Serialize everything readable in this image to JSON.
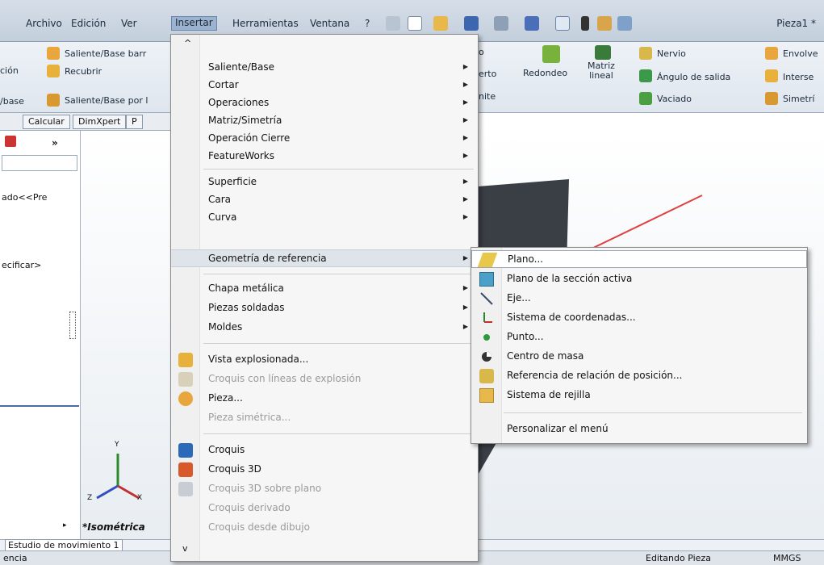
{
  "menubar": {
    "items": [
      "Archivo",
      "Edición",
      "Ver",
      "Insertar",
      "Herramientas",
      "Ventana",
      "?"
    ],
    "active": "Insertar",
    "document_title": "Pieza1 *"
  },
  "ribbon": {
    "left_labels": [
      "Saliente/Base barr",
      "Recubrir",
      "Saliente/Base por l"
    ],
    "left_cut": [
      "ción",
      "/base"
    ],
    "mid_cut": [
      "o",
      "erto",
      "nite"
    ],
    "redondeo": "Redondeo",
    "matriz": "Matriz\nlineal",
    "right_labels": [
      "Nervio",
      "Ángulo de salida",
      "Vaciado"
    ],
    "far_labels": [
      "Envolve",
      "Interse",
      "Simetrí"
    ]
  },
  "command_tabs": [
    "Calcular",
    "DimXpert",
    "P"
  ],
  "left_panel": {
    "tree_text_1": "ado<<Pre",
    "tree_text_2": "ecificar>"
  },
  "viewport": {
    "view_label": "*Isométrica",
    "axis_y": "Y",
    "axis_x": "X",
    "axis_z": "Z"
  },
  "bottom": {
    "tab_label": "Estudio de movimiento 1",
    "status_left": "encia",
    "status_mid": "Editando Pieza",
    "status_right": "MMGS"
  },
  "insert_menu": {
    "top_arrow": "^",
    "bottom_arrow": "v",
    "items": [
      {
        "label": "Saliente/Base",
        "sub": true
      },
      {
        "label": "Cortar",
        "sub": true
      },
      {
        "label": "Operaciones",
        "sub": true
      },
      {
        "label": "Matriz/Simetría",
        "sub": true
      },
      {
        "label": "Operación Cierre",
        "sub": true
      },
      {
        "label": "FeatureWorks",
        "sub": true
      },
      {
        "label": "Superficie",
        "sub": true
      },
      {
        "label": "Cara",
        "sub": true
      },
      {
        "label": "Curva",
        "sub": true
      },
      {
        "label": "Geometría de referencia",
        "sub": true
      },
      {
        "label": "Chapa metálica",
        "sub": true
      },
      {
        "label": "Piezas soldadas",
        "sub": true
      },
      {
        "label": "Moldes",
        "sub": true
      },
      {
        "label": "Vista explosionada...",
        "sub": false
      },
      {
        "label": "Croquis con líneas de explosión",
        "sub": false
      },
      {
        "label": "Pieza...",
        "sub": false
      },
      {
        "label": "Pieza simétrica...",
        "sub": false
      },
      {
        "label": "Croquis",
        "sub": false
      },
      {
        "label": "Croquis 3D",
        "sub": false
      },
      {
        "label": "Croquis 3D sobre plano",
        "sub": false
      },
      {
        "label": "Croquis derivado",
        "sub": false
      },
      {
        "label": "Croquis desde dibujo",
        "sub": false
      }
    ]
  },
  "ref_geometry_submenu": {
    "items": [
      "Plano...",
      "Plano de la sección activa",
      "Eje...",
      "Sistema de coordenadas...",
      "Punto...",
      "Centro de masa",
      "Referencia de relación de posición...",
      "Sistema de rejilla",
      "Personalizar el menú"
    ]
  },
  "colors": {
    "arrow": "#e04040",
    "block_dark": "#3a3f46",
    "menu_bg": "#f6f6f6"
  }
}
